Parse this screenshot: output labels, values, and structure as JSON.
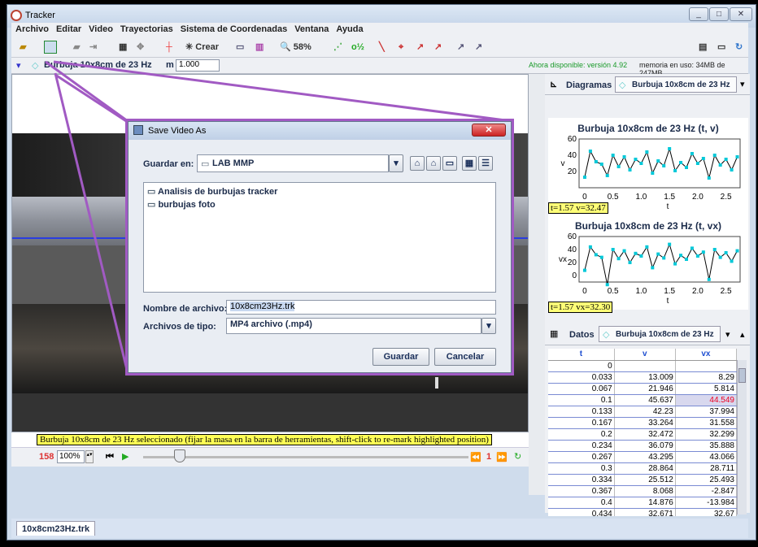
{
  "app": {
    "title": "Tracker"
  },
  "menu": [
    "Archivo",
    "Editar",
    "Video",
    "Trayectorias",
    "Sistema de Coordenadas",
    "Ventana",
    "Ayuda"
  ],
  "toolbar": {
    "crear": "Crear",
    "zoom": "58%"
  },
  "trackbar": {
    "track": "Burbuja 10x8cm de 23 Hz",
    "mass_label": "m",
    "mass_value": "1.000",
    "update": "Ahora disponible: versión 4.92",
    "memory": "memoria en uso: 34MB de 247MB"
  },
  "status": {
    "message": "Burbuja 10x8cm de 23 Hz seleccionado (fijar la masa en la barra de herramientas, shift-click to re-mark highlighted position)"
  },
  "player": {
    "frame": "158",
    "rate": "100%",
    "step": "1"
  },
  "file_tab": "10x8cm23Hz.trk",
  "dialog": {
    "title": "Save Video As",
    "look_in_label": "Guardar en:",
    "look_in_value": "LAB MMP",
    "items": [
      "Analisis de burbujas tracker",
      "burbujas foto"
    ],
    "filename_label": "Nombre de archivo:",
    "filename_value": "10x8cm23Hz.trk",
    "filetype_label": "Archivos de tipo:",
    "filetype_value": "MP4 archivo (.mp4)",
    "save": "Guardar",
    "cancel": "Cancelar"
  },
  "plots_tab": {
    "label": "Diagramas",
    "track": "Burbuja 10x8cm de 23 Hz"
  },
  "data_tab": {
    "label": "Datos",
    "track": "Burbuja 10x8cm de 23 Hz"
  },
  "readouts": {
    "v": "t=1.57  v=32.47",
    "vx": "t=1.57  vx=32.30"
  },
  "table": {
    "headers": [
      "t",
      "v",
      "vx"
    ],
    "rows": [
      [
        "0",
        "",
        ""
      ],
      [
        "0.033",
        "13.009",
        "8.29"
      ],
      [
        "0.067",
        "21.946",
        "5.814"
      ],
      [
        "0.1",
        "45.637",
        "44.549"
      ],
      [
        "0.133",
        "42.23",
        "37.994"
      ],
      [
        "0.167",
        "33.264",
        "31.558"
      ],
      [
        "0.2",
        "32.472",
        "32.299"
      ],
      [
        "0.234",
        "36.079",
        "35.888"
      ],
      [
        "0.267",
        "43.295",
        "43.066"
      ],
      [
        "0.3",
        "28.864",
        "28.711"
      ],
      [
        "0.334",
        "25.512",
        "25.493"
      ],
      [
        "0.367",
        "8.068",
        "-2.847"
      ],
      [
        "0.4",
        "14.876",
        "-13.984"
      ],
      [
        "0.434",
        "32.671",
        "32.67"
      ]
    ]
  },
  "chart_data": [
    {
      "type": "line",
      "title": "Burbuja 10x8cm de 23 Hz (t, v)",
      "xlabel": "t",
      "ylabel": "v",
      "xlim": [
        -0.1,
        2.75
      ],
      "ylim": [
        0,
        60
      ],
      "x_ticks": [
        "0",
        "0.5",
        "1.0",
        "1.5",
        "2.0",
        "2.5"
      ],
      "y_ticks": [
        "20",
        "40",
        "60"
      ],
      "x": [
        0,
        0.1,
        0.2,
        0.3,
        0.4,
        0.5,
        0.6,
        0.7,
        0.8,
        0.9,
        1.0,
        1.1,
        1.2,
        1.3,
        1.4,
        1.5,
        1.6,
        1.7,
        1.8,
        1.9,
        2.0,
        2.1,
        2.2,
        2.3,
        2.4,
        2.5,
        2.6,
        2.7
      ],
      "values": [
        13,
        45,
        32,
        29,
        15,
        40,
        26,
        38,
        22,
        35,
        30,
        44,
        18,
        33,
        27,
        48,
        21,
        31,
        25,
        42,
        30,
        36,
        12,
        40,
        28,
        35,
        22,
        38
      ],
      "color": "#00c8d8"
    },
    {
      "type": "line",
      "title": "Burbuja 10x8cm de 23 Hz (t, vx)",
      "xlabel": "t",
      "ylabel": "vx",
      "xlim": [
        -0.1,
        2.75
      ],
      "ylim": [
        -10,
        60
      ],
      "x_ticks": [
        "0",
        "0.5",
        "1.0",
        "1.5",
        "2.0",
        "2.5"
      ],
      "y_ticks": [
        "0",
        "20",
        "40",
        "60"
      ],
      "x": [
        0,
        0.1,
        0.2,
        0.3,
        0.4,
        0.5,
        0.6,
        0.7,
        0.8,
        0.9,
        1.0,
        1.1,
        1.2,
        1.3,
        1.4,
        1.5,
        1.6,
        1.7,
        1.8,
        1.9,
        2.0,
        2.1,
        2.2,
        2.3,
        2.4,
        2.5,
        2.6,
        2.7
      ],
      "values": [
        8,
        44,
        32,
        28,
        -14,
        40,
        26,
        38,
        20,
        34,
        30,
        44,
        12,
        33,
        27,
        48,
        18,
        31,
        25,
        42,
        30,
        36,
        -6,
        40,
        28,
        35,
        22,
        38
      ],
      "color": "#00c8d8"
    }
  ]
}
